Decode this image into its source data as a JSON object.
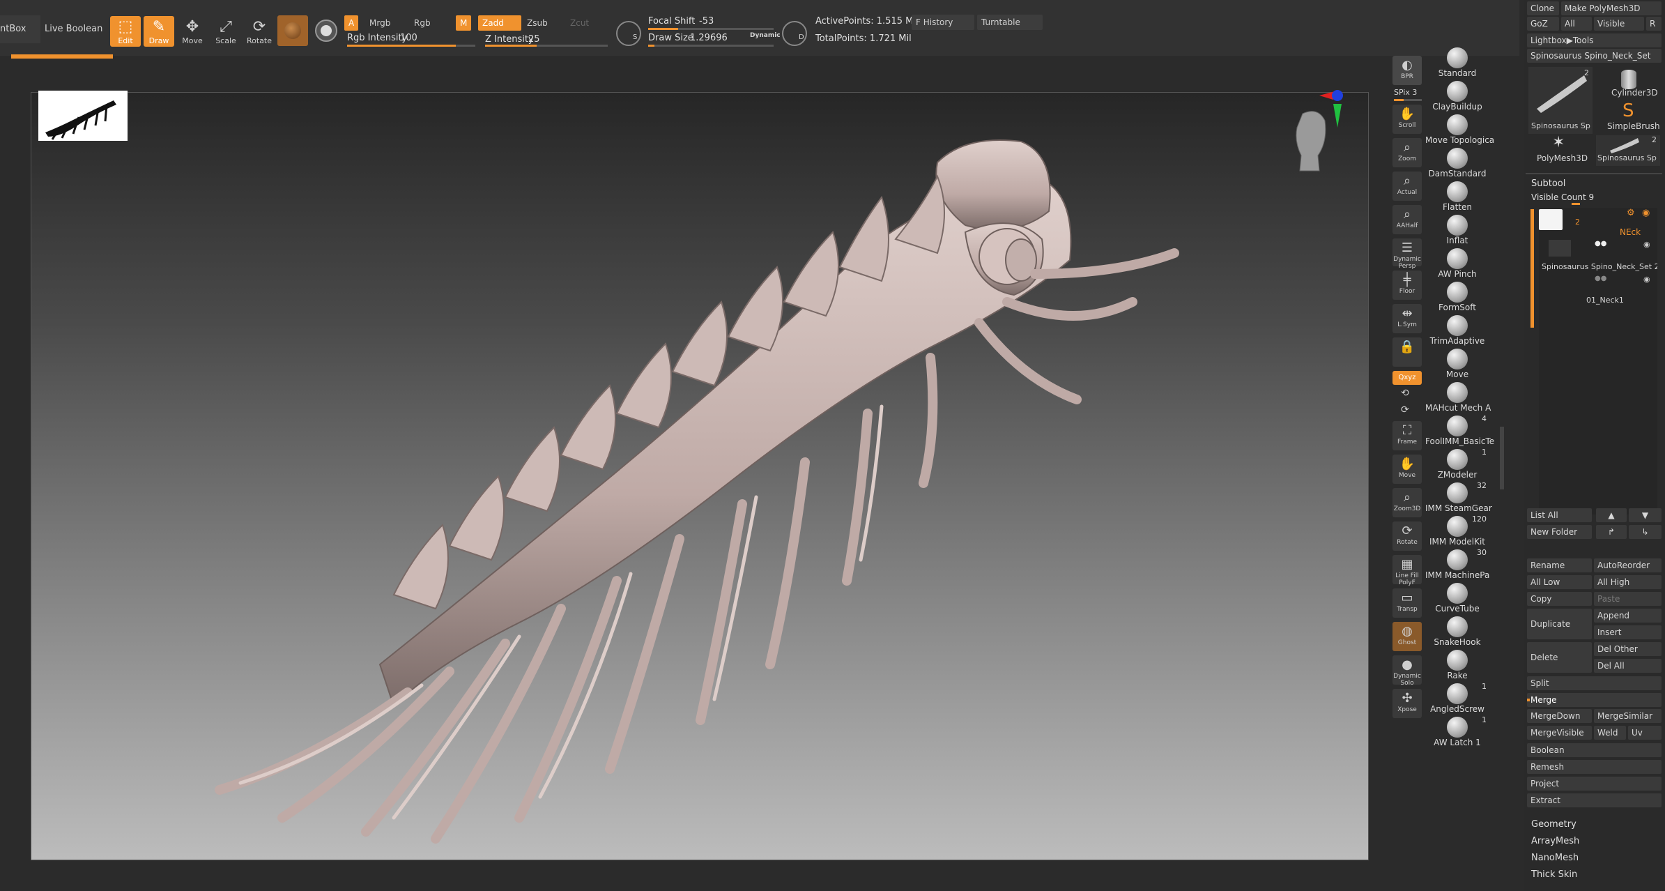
{
  "toolbar": {
    "left_tab": "ntBox",
    "live_boolean": "Live Boolean",
    "modes": [
      "Edit",
      "Draw",
      "Move",
      "Scale",
      "Rotate"
    ],
    "a_label": "A",
    "mrgb": "Mrgb",
    "rgb": "Rgb",
    "m_label": "M",
    "zadd": "Zadd",
    "zsub": "Zsub",
    "zcut": "Zcut",
    "rgb_intensity_label": "Rgb Intensity",
    "rgb_intensity_value": "100",
    "z_intensity_label": "Z Intensity",
    "z_intensity_value": "25",
    "focal_shift_label": "Focal Shift",
    "focal_shift_value": "-53",
    "draw_size_label": "Draw Size",
    "draw_size_value": "1.29696",
    "dynamic": "Dynamic",
    "active_points": "ActivePoints: 1.515 Mil",
    "total_points": "TotalPoints: 1.721 Mil",
    "f_history": "F History",
    "turntable": "Turntable",
    "s_label": "S",
    "d_label": "D",
    "rgb_intensity_level": 0.85,
    "z_intensity_level": 0.42,
    "focal_shift_level": 0.24,
    "draw_size_level": 0.05
  },
  "view_tools": [
    {
      "label": "BPR"
    },
    {
      "label": "SPix 3"
    },
    {
      "label": "Scroll"
    },
    {
      "label": "Zoom"
    },
    {
      "label": "Actual"
    },
    {
      "label": "AAHalf"
    },
    {
      "label": "Dynamic Persp"
    },
    {
      "label": "Floor"
    },
    {
      "label": "L.Sym"
    },
    {
      "label": ""
    },
    {
      "label": "Qxyz"
    },
    {
      "label": ""
    },
    {
      "label": ""
    },
    {
      "label": "Frame"
    },
    {
      "label": "Move"
    },
    {
      "label": "Zoom3D"
    },
    {
      "label": "Rotate"
    },
    {
      "label": "Line Fill PolyF"
    },
    {
      "label": "Transp"
    },
    {
      "label": "Ghost"
    },
    {
      "label": "Dynamic Solo"
    },
    {
      "label": "Xpose"
    }
  ],
  "brushes": [
    {
      "label": "Standard",
      "count": ""
    },
    {
      "label": "ClayBuildup",
      "count": ""
    },
    {
      "label": "Move Topologica",
      "count": ""
    },
    {
      "label": "DamStandard",
      "count": ""
    },
    {
      "label": "Flatten",
      "count": ""
    },
    {
      "label": "Inflat",
      "count": ""
    },
    {
      "label": "AW Pinch",
      "count": ""
    },
    {
      "label": "FormSoft",
      "count": ""
    },
    {
      "label": "TrimAdaptive",
      "count": ""
    },
    {
      "label": "Move",
      "count": ""
    },
    {
      "label": "MAHcut Mech A",
      "count": ""
    },
    {
      "label": "FoolIMM_BasicTe",
      "count": "4"
    },
    {
      "label": "ZModeler",
      "count": "1"
    },
    {
      "label": "IMM SteamGear",
      "count": "32"
    },
    {
      "label": "IMM ModelKit",
      "count": "120"
    },
    {
      "label": "IMM MachinePa",
      "count": "30"
    },
    {
      "label": "CurveTube",
      "count": ""
    },
    {
      "label": "SnakeHook",
      "count": ""
    },
    {
      "label": "Rake",
      "count": ""
    },
    {
      "label": "AngledScrew",
      "count": "1"
    },
    {
      "label": "AW Latch 1",
      "count": "1"
    }
  ],
  "panel": {
    "clone": "Clone",
    "make_polymesh": "Make PolyMesh3D",
    "goz": "GoZ",
    "all": "All",
    "visible": "Visible",
    "r": "R",
    "lightbox_tools": "Lightbox▶Tools",
    "current_tool": "Spinosaurus Spino_Neck_Set",
    "tools": [
      {
        "name": "Spinosaurus Sp",
        "count": "2"
      },
      {
        "name": "Cylinder3D",
        "count": ""
      },
      {
        "name": "SimpleBrush",
        "count": ""
      },
      {
        "name": "PolyMesh3D",
        "count": ""
      },
      {
        "name": "Spinosaurus Sp",
        "count": "2"
      }
    ],
    "subtool_title": "Subtool",
    "visible_count": "Visible Count 9",
    "folder_count": "2",
    "folder_name": "NEck",
    "subtool_1": "Spinosaurus Spino_Neck_Set 2",
    "subtool_2": "01_Neck1",
    "list_all": "List All",
    "new_folder": "New Folder",
    "rename": "Rename",
    "autoreorder": "AutoReorder",
    "all_low": "All Low",
    "all_high": "All High",
    "copy": "Copy",
    "paste": "Paste",
    "duplicate": "Duplicate",
    "append": "Append",
    "insert": "Insert",
    "delete": "Delete",
    "del_other": "Del Other",
    "del_all": "Del All",
    "split": "Split",
    "merge": "Merge",
    "mergedown": "MergeDown",
    "mergesimilar": "MergeSimilar",
    "mergevisible": "MergeVisible",
    "weld": "Weld",
    "uv": "Uv",
    "boolean": "Boolean",
    "remesh": "Remesh",
    "project": "Project",
    "extract": "Extract",
    "geometry": "Geometry",
    "arraymesh": "ArrayMesh",
    "nanomesh": "NanoMesh",
    "thick_skin": "Thick Skin"
  },
  "colors": {
    "accent": "#f0922e",
    "model": "#cbb8b4",
    "bg_dark": "#2a2a2a"
  }
}
